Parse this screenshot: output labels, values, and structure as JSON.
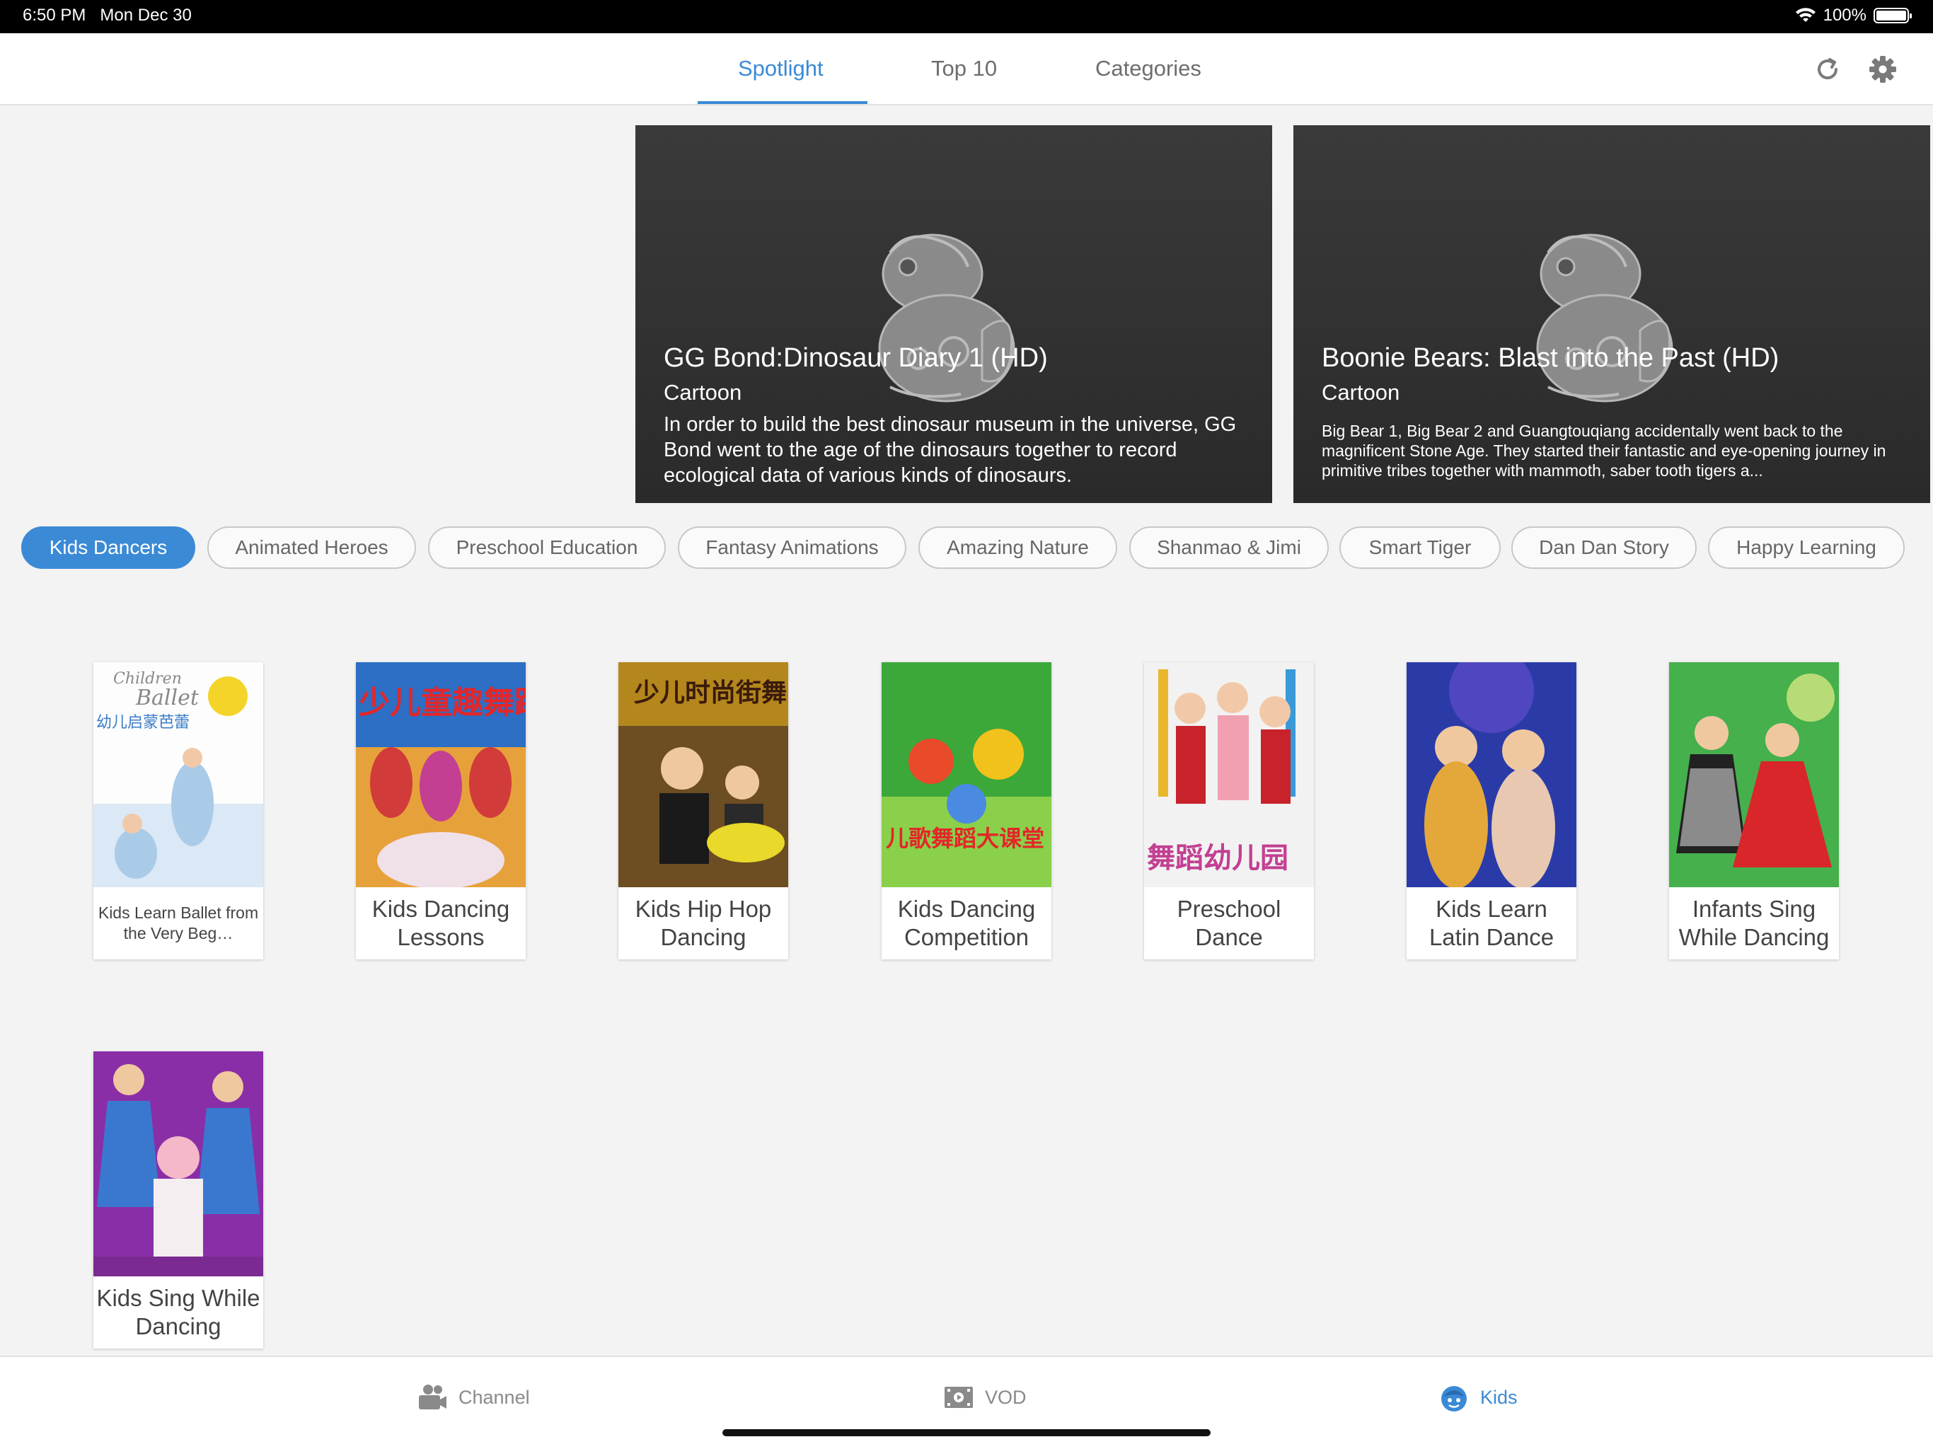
{
  "status": {
    "time": "6:50 PM",
    "date": "Mon Dec 30",
    "battery": "100%",
    "battery_level": 1.0
  },
  "nav": {
    "tabs": [
      {
        "label": "Spotlight",
        "active": true
      },
      {
        "label": "Top 10",
        "active": false
      },
      {
        "label": "Categories",
        "active": false
      }
    ],
    "icons": [
      "refresh-icon",
      "gear-icon"
    ],
    "accent": "#3a8ad6"
  },
  "banners": [
    {
      "title": "GG Bond:Dinosaur Diary 1 (HD)",
      "genre": "Cartoon",
      "description": "In order to build the best dinosaur museum in the universe, GG Bond went to the age of the dinosaurs together to record ecological data of various kinds of dinosaurs."
    },
    {
      "title": "Boonie Bears: Blast into the Past (HD)",
      "genre": "Cartoon",
      "description": "Big Bear 1, Big Bear 2 and Guangtouqiang accidentally went back to the magnificent Stone Age. They started their fantastic and eye-opening journey in primitive tribes together with mammoth, saber tooth tigers a..."
    }
  ],
  "categories": [
    {
      "label": "Kids Dancers",
      "active": true
    },
    {
      "label": "Animated Heroes",
      "active": false
    },
    {
      "label": "Preschool Education",
      "active": false
    },
    {
      "label": "Fantasy Animations",
      "active": false
    },
    {
      "label": "Amazing Nature",
      "active": false
    },
    {
      "label": "Shanmao & Jimi",
      "active": false
    },
    {
      "label": "Smart Tiger",
      "active": false
    },
    {
      "label": "Dan Dan Story",
      "active": false
    },
    {
      "label": "Happy Learning",
      "active": false
    }
  ],
  "items": [
    {
      "title": "Kids Learn Ballet from the Very Beg…",
      "poster_text": "Children Ballet 幼儿启蒙芭蕾",
      "colors": [
        "#ffffff",
        "#dbe8f5"
      ]
    },
    {
      "title": "Kids Dancing Lessons",
      "poster_text": "少儿童趣舞蹈",
      "colors": [
        "#2c6fc4",
        "#e7a13a"
      ]
    },
    {
      "title": "Kids Hip Hop Dancing",
      "poster_text": "少儿时尚街舞",
      "colors": [
        "#b4871d",
        "#3a2a1a"
      ]
    },
    {
      "title": "Kids Dancing Competition",
      "poster_text": "儿歌舞蹈大课堂",
      "colors": [
        "#3ca83a",
        "#8ad04a"
      ]
    },
    {
      "title": "Preschool Dance",
      "poster_text": "舞蹈幼儿园",
      "colors": [
        "#f2f2f2",
        "#c8334a"
      ]
    },
    {
      "title": "Kids Learn Latin Dance",
      "poster_text": "",
      "colors": [
        "#2a3ba8",
        "#e4a83a"
      ]
    },
    {
      "title": "Infants Sing While Dancing",
      "poster_text": "",
      "colors": [
        "#45b04c",
        "#d8262a"
      ]
    },
    {
      "title": "Kids Sing While Dancing",
      "poster_text": "",
      "colors": [
        "#8a2ea8",
        "#3a78d0"
      ]
    }
  ],
  "bottom_tabs": [
    {
      "label": "Channel",
      "icon": "camera-icon",
      "active": false
    },
    {
      "label": "VOD",
      "icon": "film-icon",
      "active": false
    },
    {
      "label": "Kids",
      "icon": "kid-face-icon",
      "active": true
    }
  ]
}
